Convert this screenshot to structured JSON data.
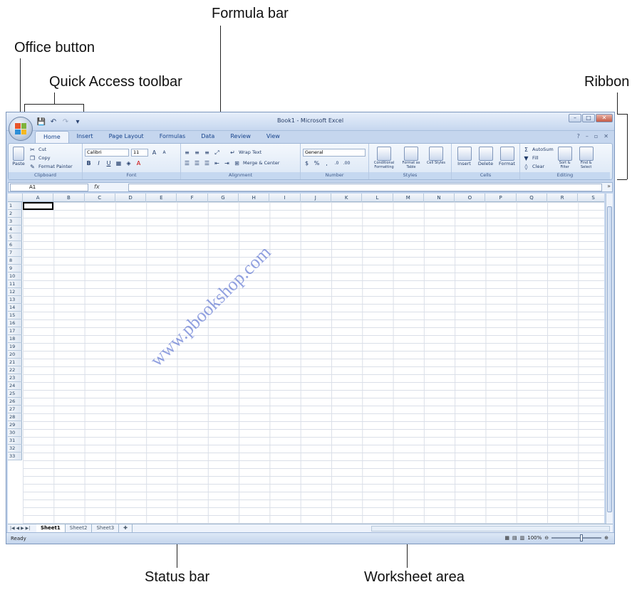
{
  "callouts": {
    "formula_bar": "Formula bar",
    "office_button": "Office button",
    "quick_access": "Quick Access toolbar",
    "ribbon": "Ribbon",
    "status_bar": "Status bar",
    "worksheet_area": "Worksheet area"
  },
  "window": {
    "title": "Book1 - Microsoft Excel"
  },
  "tabs": [
    "Home",
    "Insert",
    "Page Layout",
    "Formulas",
    "Data",
    "Review",
    "View"
  ],
  "ribbon": {
    "clipboard": {
      "paste": "Paste",
      "cut": "Cut",
      "copy": "Copy",
      "format_painter": "Format Painter",
      "label": "Clipboard"
    },
    "font": {
      "name": "Calibri",
      "size": "11",
      "label": "Font"
    },
    "alignment": {
      "wrap": "Wrap Text",
      "merge": "Merge & Center",
      "label": "Alignment"
    },
    "number": {
      "format": "General",
      "label": "Number"
    },
    "styles": {
      "conditional": "Conditional Formatting",
      "format_table": "Format as Table",
      "cell_styles": "Cell Styles",
      "label": "Styles"
    },
    "cells": {
      "insert": "Insert",
      "delete": "Delete",
      "format": "Format",
      "label": "Cells"
    },
    "editing": {
      "autosum": "AutoSum",
      "fill": "Fill",
      "clear": "Clear",
      "sort": "Sort & Filter",
      "find": "Find & Select",
      "label": "Editing"
    }
  },
  "formula_bar": {
    "name_box": "A1",
    "fx": "fx"
  },
  "columns": [
    "A",
    "B",
    "C",
    "D",
    "E",
    "F",
    "G",
    "H",
    "I",
    "J",
    "K",
    "L",
    "M",
    "N",
    "O",
    "P",
    "Q",
    "R",
    "S"
  ],
  "rows": [
    "1",
    "2",
    "3",
    "4",
    "5",
    "6",
    "7",
    "8",
    "9",
    "10",
    "11",
    "12",
    "13",
    "14",
    "15",
    "16",
    "17",
    "18",
    "19",
    "20",
    "21",
    "22",
    "23",
    "24",
    "25",
    "26",
    "27",
    "28",
    "29",
    "30",
    "31",
    "32",
    "33"
  ],
  "sheets": [
    "Sheet1",
    "Sheet2",
    "Sheet3"
  ],
  "status": {
    "ready": "Ready",
    "zoom": "100%"
  },
  "watermark": "www.pbookshop.com",
  "colors": {
    "office_blue": "#c5d6ee",
    "tab_text": "#15428b"
  }
}
